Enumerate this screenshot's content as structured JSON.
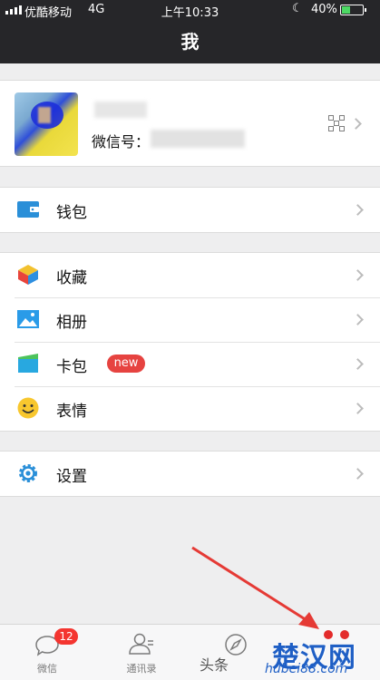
{
  "status": {
    "carrier": "优酷移动",
    "network": "4G",
    "time": "上午10:33",
    "battery": "40%",
    "battery_level": 0.4
  },
  "nav": {
    "title": "我"
  },
  "profile": {
    "wechat_id_label": "微信号：",
    "qr_icon": "qr-code-icon"
  },
  "menu": {
    "wallet": "钱包",
    "favorites": "收藏",
    "album": "相册",
    "cards": "卡包",
    "cards_badge": "new",
    "stickers": "表情",
    "settings": "设置"
  },
  "tabs": [
    {
      "label": "微信",
      "badge": "12"
    },
    {
      "label": "通讯录"
    },
    {
      "label": ""
    },
    {
      "label": ""
    }
  ],
  "watermark": {
    "text": "头条",
    "logo": "楚汉网",
    "url": "hubei88.com"
  },
  "colors": {
    "bar": "#262629",
    "accent": "#e64340",
    "wallet_blue": "#2a8fd8"
  }
}
